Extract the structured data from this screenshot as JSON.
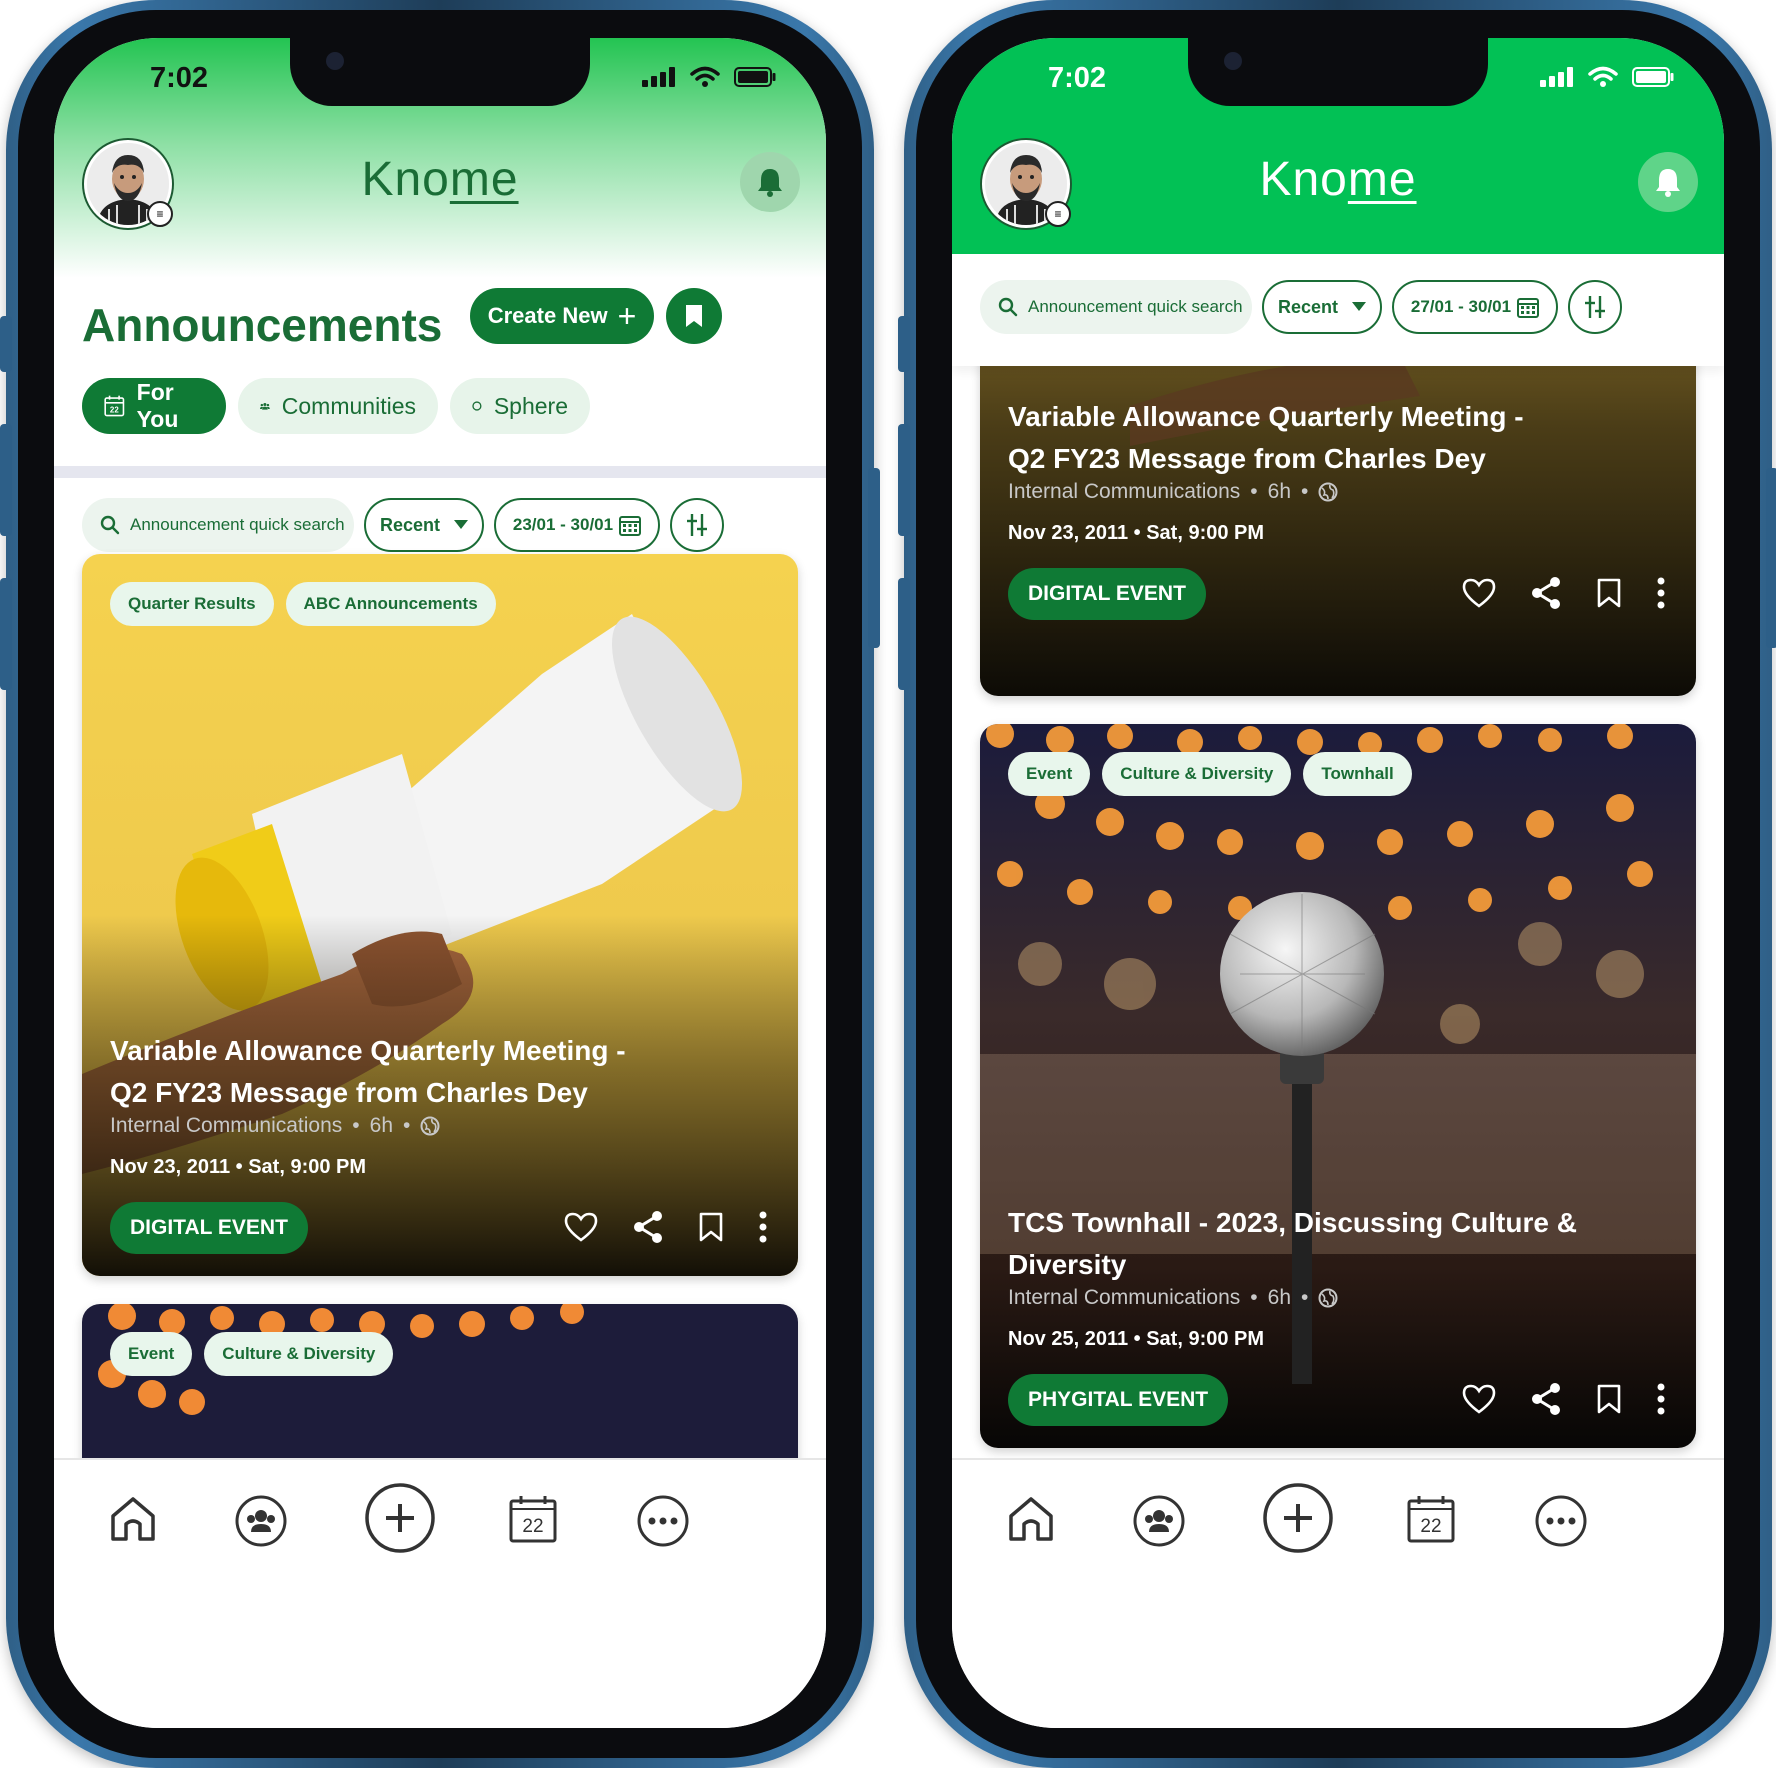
{
  "status": {
    "time": "7:02"
  },
  "app": {
    "logo_prefix": "Kno",
    "logo_suffix": "me"
  },
  "page": {
    "title": "Announcements",
    "create_label": "Create New"
  },
  "tabs": [
    {
      "label": "For You",
      "icon": "calendar-icon",
      "day": "22"
    },
    {
      "label": "Communities",
      "icon": "people-icon"
    },
    {
      "label": "Sphere",
      "icon": "circle-icon"
    }
  ],
  "filters_left": {
    "search_placeholder": "Announcement quick search",
    "sort": "Recent",
    "date_range": "23/01 - 30/01"
  },
  "filters_right": {
    "search_placeholder": "Announcement quick search",
    "sort": "Recent",
    "date_range": "27/01 - 30/01"
  },
  "cards": [
    {
      "tags": [
        "Quarter Results",
        "ABC Announcements"
      ],
      "title": "Variable Allowance Quarterly Meeting - Q2 FY23 Message from Charles Dey",
      "source": "Internal Communications",
      "age": "6h",
      "date": "Nov 23, 2011 • Sat, 9:00 PM",
      "badge": "DIGITAL EVENT"
    },
    {
      "tags": [
        "Event",
        "Culture & Diversity",
        "Townhall"
      ],
      "title": "TCS Townhall - 2023, Discussing Culture & Diversity",
      "source": "Internal Communications",
      "age": "6h",
      "date": "Nov 25, 2011 • Sat, 9:00 PM",
      "badge": "PHYGITAL EVENT"
    }
  ],
  "peek_card_tags": [
    "Event",
    "Culture & Diversity"
  ],
  "nav": {
    "calendar_day": "22"
  },
  "colors": {
    "brand_green": "#0f7a35",
    "header_green": "#02c155",
    "text_green": "#1a6d36"
  }
}
